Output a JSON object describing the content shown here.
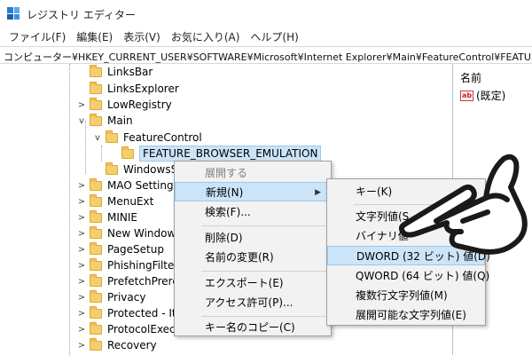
{
  "window": {
    "title": "レジストリ エディター"
  },
  "menubar": [
    "ファイル(F)",
    "編集(E)",
    "表示(V)",
    "お気に入り(A)",
    "ヘルプ(H)"
  ],
  "address": "コンピューター¥HKEY_CURRENT_USER¥SOFTWARE¥Microsoft¥Internet Explorer¥Main¥FeatureControl¥FEATURE_BROWSER_EMULATION",
  "tree": [
    {
      "label": "LinksBar",
      "chevron": ""
    },
    {
      "label": "LinksExplorer",
      "chevron": ""
    },
    {
      "label": "LowRegistry",
      "chevron": ">"
    },
    {
      "label": "Main",
      "chevron": "v"
    },
    {
      "label": "FeatureControl",
      "chevron": "v"
    },
    {
      "label": "FEATURE_BROWSER_EMULATION",
      "chevron": ""
    },
    {
      "label": "WindowsSe",
      "chevron": ""
    },
    {
      "label": "MAO Settings",
      "chevron": ">"
    },
    {
      "label": "MenuExt",
      "chevron": ">"
    },
    {
      "label": "MINIE",
      "chevron": ">"
    },
    {
      "label": "New Windows",
      "chevron": ">"
    },
    {
      "label": "PageSetup",
      "chevron": ">"
    },
    {
      "label": "PhishingFilter",
      "chevron": ">"
    },
    {
      "label": "PrefetchPrerer",
      "chevron": ">"
    },
    {
      "label": "Privacy",
      "chevron": ">"
    },
    {
      "label": "Protected - It",
      "chevron": ">"
    },
    {
      "label": "ProtocolExecu",
      "chevron": ">"
    },
    {
      "label": "Recovery",
      "chevron": ">"
    }
  ],
  "values_pane": {
    "header": "名前",
    "icon_text": "ab",
    "row": "(既定)"
  },
  "context_menu": [
    {
      "label": "展開する",
      "disabled": true
    },
    {
      "label": "新規(N)",
      "submenu_arrow": "▶"
    },
    {
      "label": "検索(F)..."
    },
    {
      "label": "削除(D)"
    },
    {
      "label": "名前の変更(R)"
    },
    {
      "label": "エクスポート(E)"
    },
    {
      "label": "アクセス許可(P)..."
    },
    {
      "label": "キー名のコピー(C)"
    }
  ],
  "submenu": [
    {
      "label": "キー(K)"
    },
    {
      "label": "文字列値(S"
    },
    {
      "label": "バイナリ値"
    },
    {
      "label": "DWORD (32 ビット) 値(D)"
    },
    {
      "label": "QWORD (64 ビット) 値(Q)"
    },
    {
      "label": "複数行文字列値(M)"
    },
    {
      "label": "展開可能な文字列値(E)"
    }
  ],
  "colors": {
    "highlight": "#cce4f7",
    "highlight_border": "#99c9ef",
    "folder": "#f5cf6a",
    "menu_bg": "#f2f2f2"
  },
  "icons": {
    "app": "registry-editor-icon",
    "pointer": "pointing-hand-icon"
  }
}
